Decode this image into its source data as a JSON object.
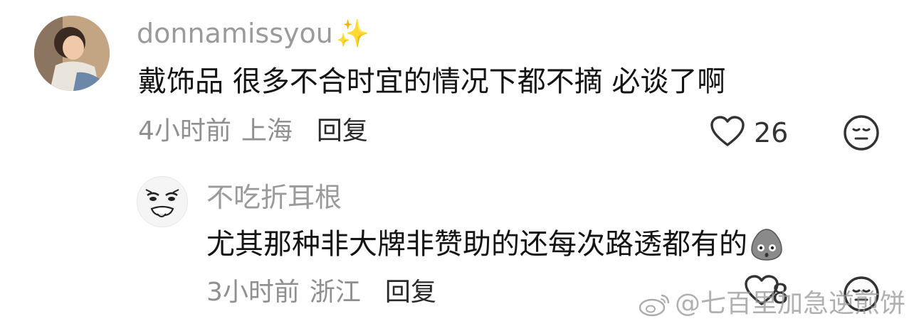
{
  "comment": {
    "username": "donnamissyou",
    "username_emoji": "✨",
    "text": "戴饰品 很多不合时宜的情况下都不摘 必谈了啊",
    "time": "4小时前",
    "location": "上海",
    "reply_label": "回复",
    "like_count": "26",
    "icons": {
      "avatar": "avatar-photo",
      "like": "heart-outline-icon",
      "dislike": "meh-face-icon"
    }
  },
  "sub_comment": {
    "username": "不吃折耳根",
    "text": "尤其那种非大牌非赞助的还每次路透都有的",
    "time": "3小时前",
    "location": "浙江",
    "reply_label": "回复",
    "like_count": "8",
    "icons": {
      "avatar": "rage-face-avatar",
      "inline_emoji": "shocked-egg-emoji",
      "like": "heart-outline-icon",
      "dislike": "meh-face-icon"
    }
  },
  "watermark": {
    "text": "@七百里加急逆煎饼",
    "icon": "weibo-logo-icon"
  },
  "colors": {
    "muted": "#9a9a9a",
    "text": "#141414",
    "icon": "#333333"
  }
}
